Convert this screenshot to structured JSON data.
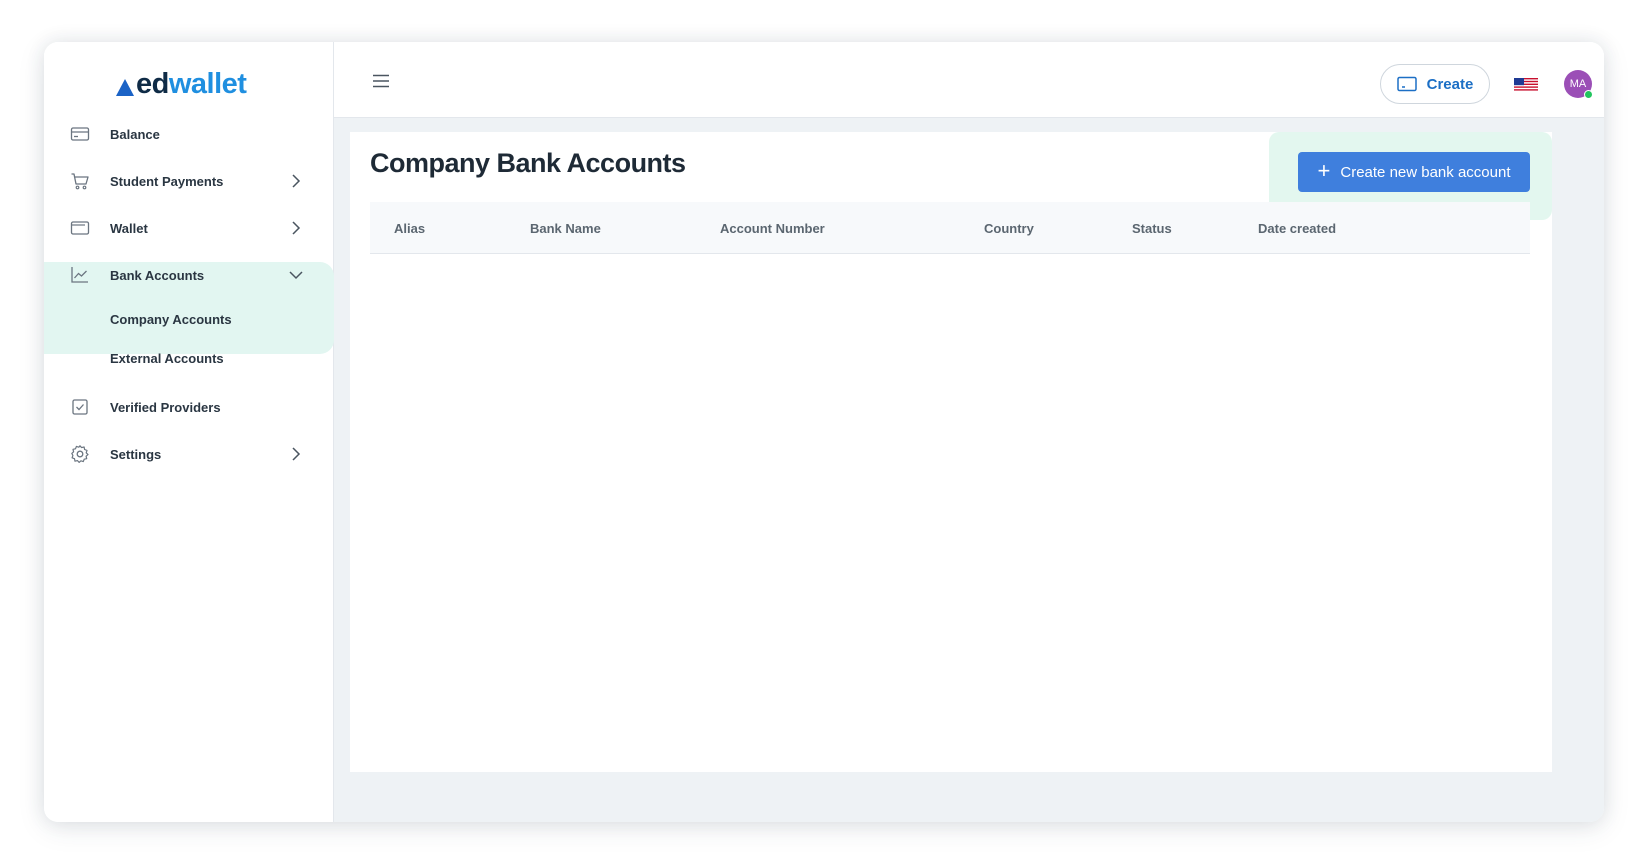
{
  "brand": {
    "ed": "ed",
    "wallet": "wallet"
  },
  "sidebar": {
    "items": [
      {
        "label": "Balance",
        "icon": "credit-card-icon"
      },
      {
        "label": "Student Payments",
        "icon": "cart-icon"
      },
      {
        "label": "Wallet",
        "icon": "wallet-icon"
      },
      {
        "label": "Bank Accounts",
        "icon": "chart-line-icon"
      },
      {
        "label": "Verified Providers",
        "icon": "checkbox-icon"
      },
      {
        "label": "Settings",
        "icon": "gear-icon"
      }
    ],
    "subitems": [
      {
        "label": "Company Accounts"
      },
      {
        "label": "External Accounts"
      }
    ]
  },
  "topbar": {
    "create_label": "Create",
    "avatar_initials": "MA"
  },
  "main": {
    "title": "Company Bank Accounts",
    "new_button_label": "Create new bank account",
    "table": {
      "columns": [
        "Alias",
        "Bank Name",
        "Account Number",
        "Country",
        "Status",
        "Date created"
      ],
      "rows": []
    }
  },
  "colors": {
    "accent": "#3f7fdd",
    "active_bg": "#e2f6f1",
    "brand_blue": "#1f8fe0",
    "avatar": "#9b4fb6"
  }
}
